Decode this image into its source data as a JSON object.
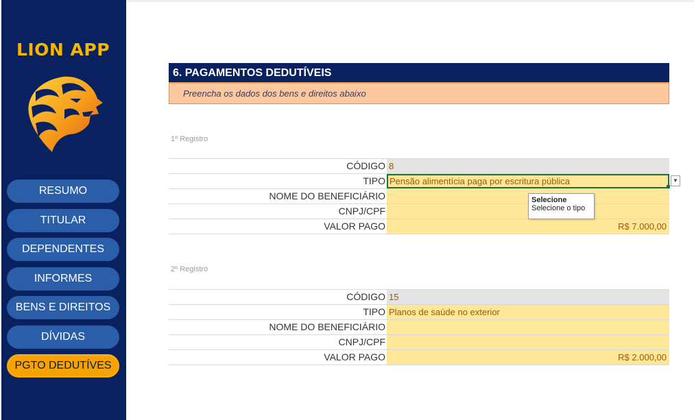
{
  "app": {
    "title": "LION APP"
  },
  "logo": {
    "icon": "lion-head-icon"
  },
  "nav": {
    "items": [
      {
        "label": "RESUMO",
        "active": false
      },
      {
        "label": "TITULAR",
        "active": false
      },
      {
        "label": "DEPENDENTES",
        "active": false
      },
      {
        "label": "INFORMES",
        "active": false
      },
      {
        "label": "BENS E DIREITOS",
        "active": false
      },
      {
        "label": "DÍVIDAS",
        "active": false
      },
      {
        "label": "PGTO DEDUTÍVES",
        "active": true
      }
    ]
  },
  "section": {
    "title": "6. PAGAMENTOS DEDUTÍVEIS",
    "subtitle": "Preencha os dados dos bens e direitos abaixo"
  },
  "registros": [
    {
      "label": "1º Registro",
      "fields": [
        {
          "label": "CÓDIGO",
          "value": "8"
        },
        {
          "label": "TIPO",
          "value": "Pensão alimentícia paga por escritura pública"
        },
        {
          "label": "NOME DO BENEFICIÁRIO",
          "value": ""
        },
        {
          "label": "CNPJ/CPF",
          "value": ""
        },
        {
          "label": "VALOR PAGO",
          "value": "R$ 7.000,00"
        }
      ]
    },
    {
      "label": "2º Registro",
      "fields": [
        {
          "label": "CÓDIGO",
          "value": "15"
        },
        {
          "label": "TIPO",
          "value": "Planos de saúde no exterior"
        },
        {
          "label": "NOME DO BENEFICIÁRIO",
          "value": ""
        },
        {
          "label": "CNPJ/CPF",
          "value": ""
        },
        {
          "label": "VALOR PAGO",
          "value": "R$ 2.000,00"
        }
      ]
    }
  ],
  "tooltip": {
    "title": "Selecione",
    "text": "Selecione o tipo"
  },
  "dropdown": {
    "icon": "chevron-down-icon"
  },
  "colors": {
    "sidebar": "#0a2160",
    "accent": "#f7b500",
    "nav_button": "#2a5ea8",
    "input_cell": "#ffe79a",
    "subtitle_bg": "#fdc89e"
  }
}
